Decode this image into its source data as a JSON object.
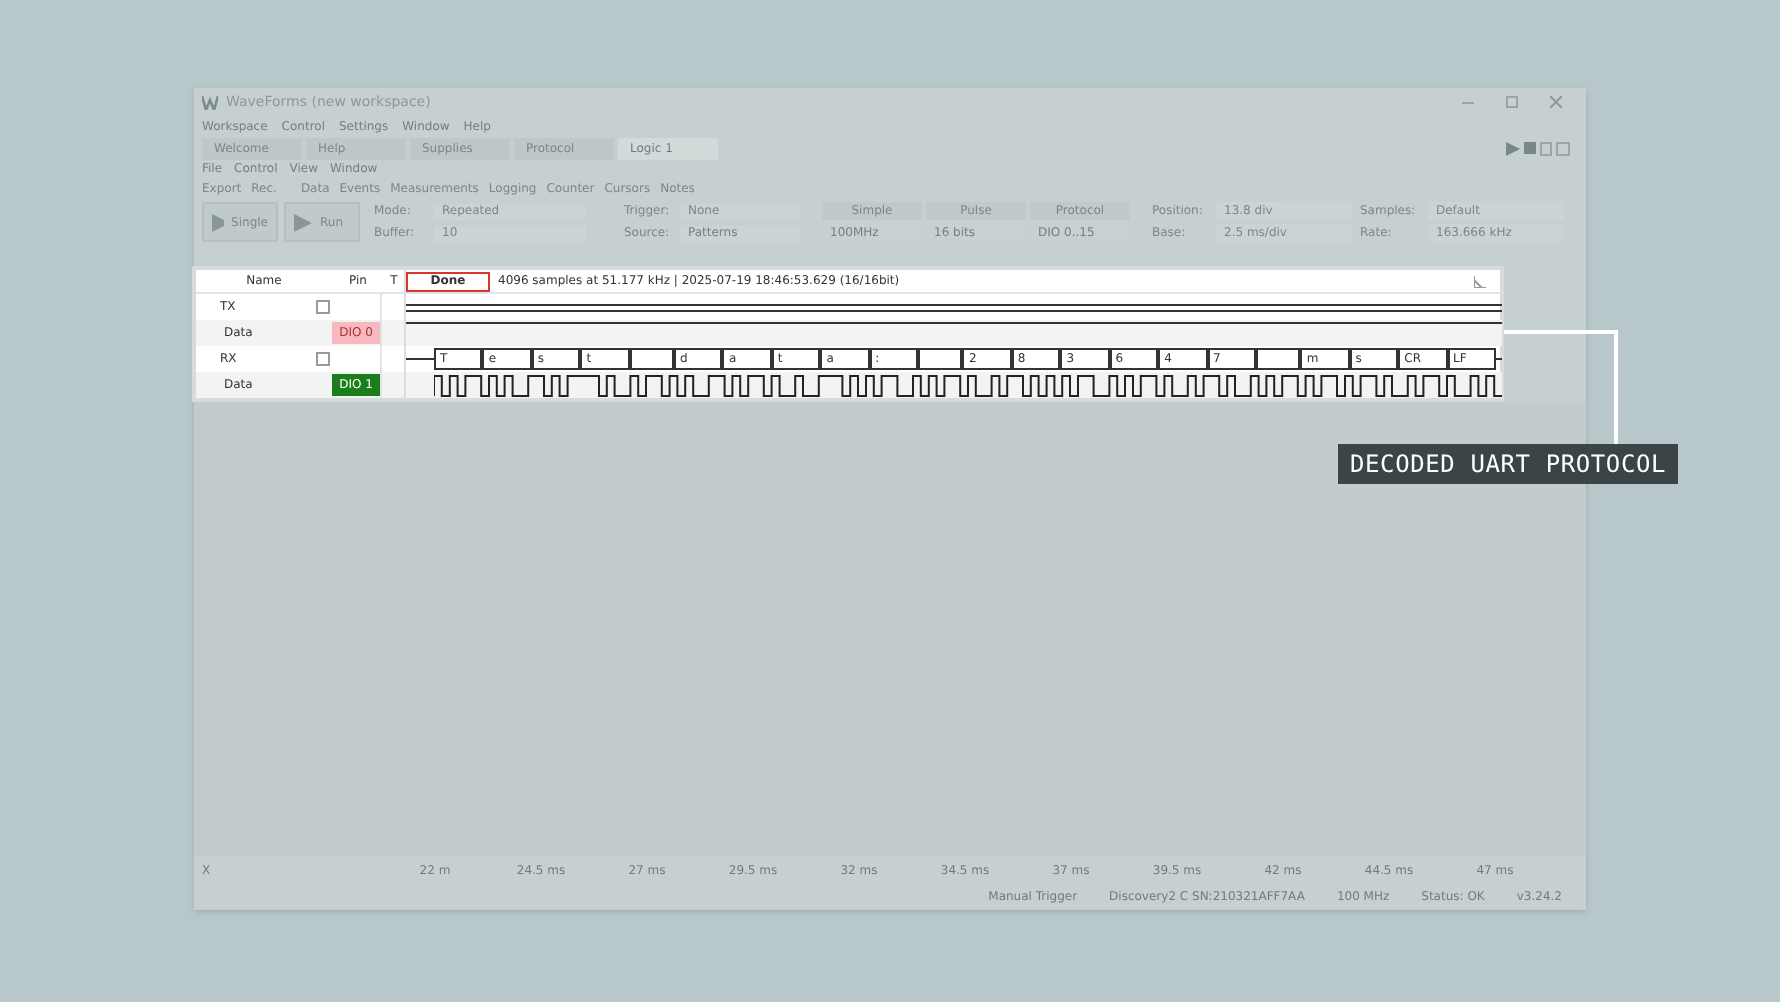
{
  "window": {
    "title": "WaveForms (new workspace)"
  },
  "menu": [
    "Workspace",
    "Control",
    "Settings",
    "Window",
    "Help"
  ],
  "tabs": [
    {
      "label": "Welcome",
      "selected": false
    },
    {
      "label": "Help",
      "selected": false
    },
    {
      "label": "Supplies",
      "selected": false
    },
    {
      "label": "Protocol",
      "selected": false
    },
    {
      "label": "Logic 1",
      "selected": true
    }
  ],
  "submenu": [
    "File",
    "Control",
    "View",
    "Window"
  ],
  "toolbar": {
    "left": [
      "Export",
      "Rec."
    ],
    "views": [
      "Data",
      "Events",
      "Measurements",
      "Logging",
      "Counter",
      "Cursors",
      "Notes"
    ]
  },
  "run_buttons": [
    "Single",
    "Run"
  ],
  "fields": [
    {
      "label": "Mode:",
      "value": "Repeated"
    },
    {
      "label": "Buffer:",
      "value": "10"
    },
    {
      "label": "Trigger:",
      "value": "None"
    },
    {
      "label": "Source:",
      "value": "Patterns"
    }
  ],
  "trigger_buttons": [
    "Simple",
    "Pulse",
    "Protocol"
  ],
  "trigger_row2": [
    "100MHz",
    "16 bits",
    "DIO 0..15"
  ],
  "time_fields": [
    {
      "label": "Position:",
      "value": "13.8 div"
    },
    {
      "label": "Base:",
      "value": "2.5 ms/div"
    },
    {
      "label": "Samples:",
      "value": "Default"
    },
    {
      "label": "Rate:",
      "value": "163.666 kHz"
    }
  ],
  "signals": {
    "columns": [
      "Name",
      "Pin",
      "T"
    ],
    "status": "Done",
    "info": "4096 samples at 51.177 kHz | 2025-07-19 18:46:53.629 (16/16bit)",
    "rows": [
      {
        "kind": "bus",
        "name": "TX"
      },
      {
        "kind": "pin",
        "name": "Data",
        "pin": "DIO 0",
        "color": "#f5b9bf"
      },
      {
        "kind": "bus",
        "name": "RX"
      },
      {
        "kind": "pin",
        "name": "Data",
        "pin": "DIO 1",
        "color": "#1b7d1b"
      }
    ],
    "decoded": [
      {
        "kind": "byte",
        "text": "T"
      },
      {
        "kind": "byte",
        "text": "e"
      },
      {
        "kind": "byte",
        "text": "s"
      },
      {
        "kind": "byte",
        "text": "t"
      },
      {
        "kind": "space"
      },
      {
        "kind": "byte",
        "text": "d"
      },
      {
        "kind": "byte",
        "text": "a"
      },
      {
        "kind": "byte",
        "text": "t"
      },
      {
        "kind": "byte",
        "text": "a"
      },
      {
        "kind": "byte",
        "text": ":"
      },
      {
        "kind": "space"
      },
      {
        "kind": "byte",
        "text": "2"
      },
      {
        "kind": "byte",
        "text": "8"
      },
      {
        "kind": "byte",
        "text": "3"
      },
      {
        "kind": "byte",
        "text": "6"
      },
      {
        "kind": "byte",
        "text": "4"
      },
      {
        "kind": "byte",
        "text": "7"
      },
      {
        "kind": "space"
      },
      {
        "kind": "byte",
        "text": "m"
      },
      {
        "kind": "byte",
        "text": "s"
      },
      {
        "kind": "byte",
        "text": "CR"
      },
      {
        "kind": "byte",
        "text": "LF"
      }
    ]
  },
  "x_axis": {
    "label": "X",
    "ticks": [
      "22 m",
      "24.5 ms",
      "27 ms",
      "29.5 ms",
      "32 ms",
      "34.5 ms",
      "37 ms",
      "39.5 ms",
      "42 ms",
      "44.5 ms",
      "47 ms"
    ]
  },
  "status_bar": [
    "Manual Trigger",
    "Discovery2 C SN:210321AFF7AA",
    "100 MHz",
    "Status: OK",
    "v3.24.2"
  ],
  "callout": "DECODED UART PROTOCOL"
}
